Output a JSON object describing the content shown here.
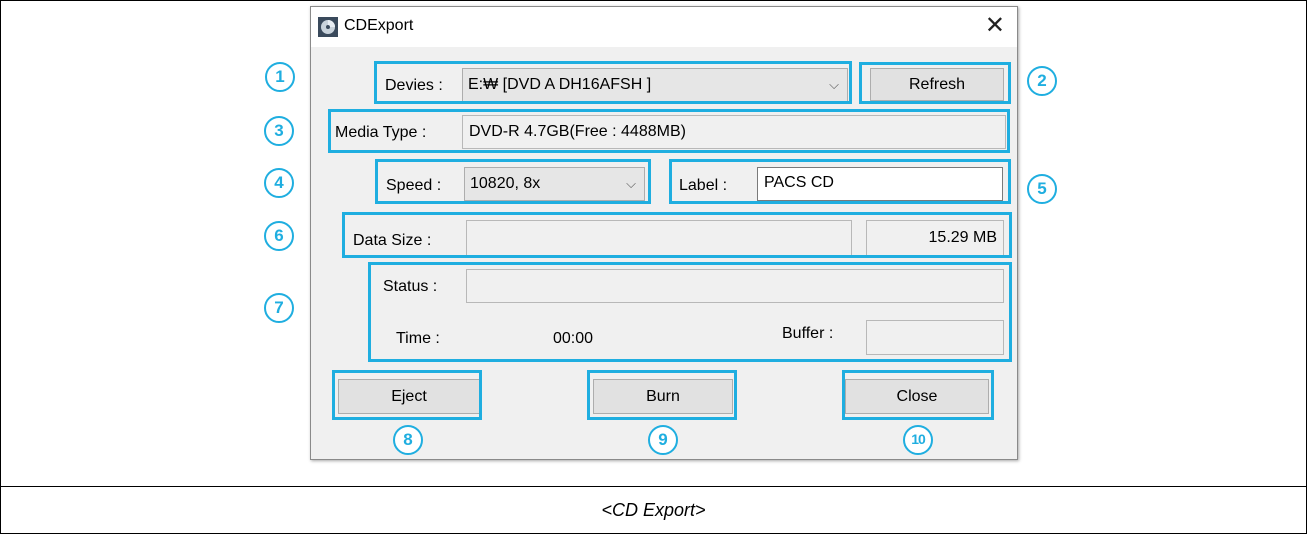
{
  "window": {
    "title": "CDExport",
    "close_glyph": "✕",
    "icon": "cd-icon"
  },
  "devices": {
    "label": "Devies :",
    "value": "E:₩ [DVD A DH16AFSH  ]"
  },
  "refresh_button": "Refresh",
  "media_type": {
    "label": "Media Type :",
    "value": "DVD-R 4.7GB(Free : 4488MB)"
  },
  "speed": {
    "label": "Speed :",
    "value": "10820, 8x"
  },
  "cd_label": {
    "label": "Label :",
    "value": "PACS CD"
  },
  "data_size": {
    "label": "Data Size :",
    "value": "15.29 MB"
  },
  "status": {
    "label": "Status :",
    "value": ""
  },
  "time": {
    "label": "Time :",
    "value": "00:00"
  },
  "buffer": {
    "label": "Buffer :",
    "value": ""
  },
  "buttons": {
    "eject": "Eject",
    "burn": "Burn",
    "close": "Close"
  },
  "markers": [
    "1",
    "2",
    "3",
    "4",
    "5",
    "6",
    "7",
    "8",
    "9",
    "10"
  ],
  "highlight_color": "#1faee0",
  "caption": "<CD Export>"
}
